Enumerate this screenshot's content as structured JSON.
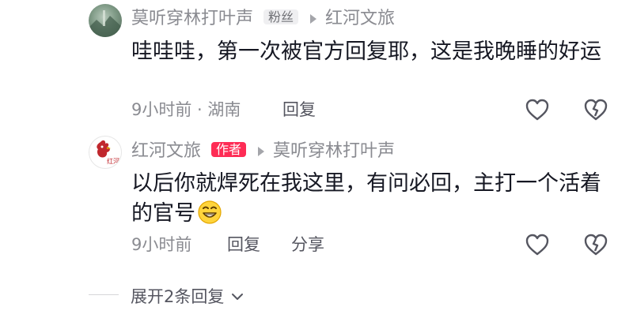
{
  "comments": [
    {
      "username": "莫听穿林打叶声",
      "badge": "粉丝",
      "reply_to": "红河文旅",
      "content": "哇哇哇，第一次被官方回复耶，这是我晚睡的好运",
      "time_location": "9小时前 · 湖南",
      "reply_label": "回复",
      "avatar": "landscape-avatar"
    },
    {
      "username": "红河文旅",
      "badge": "作者",
      "reply_to": "莫听穿林打叶声",
      "content": "以后你就焊死在我这里，有问必回，主打一个活着的官号",
      "emoji": "grinning-emoji",
      "avatar_text": "红河",
      "time": "9小时前",
      "reply_label": "回复",
      "share_label": "分享",
      "avatar": "rooster-logo-avatar"
    }
  ],
  "expand_replies": "展开2条回复",
  "colors": {
    "author_badge": "#fe2c55",
    "fan_badge_bg": "#efeff1",
    "meta_text": "#8a8b91"
  }
}
